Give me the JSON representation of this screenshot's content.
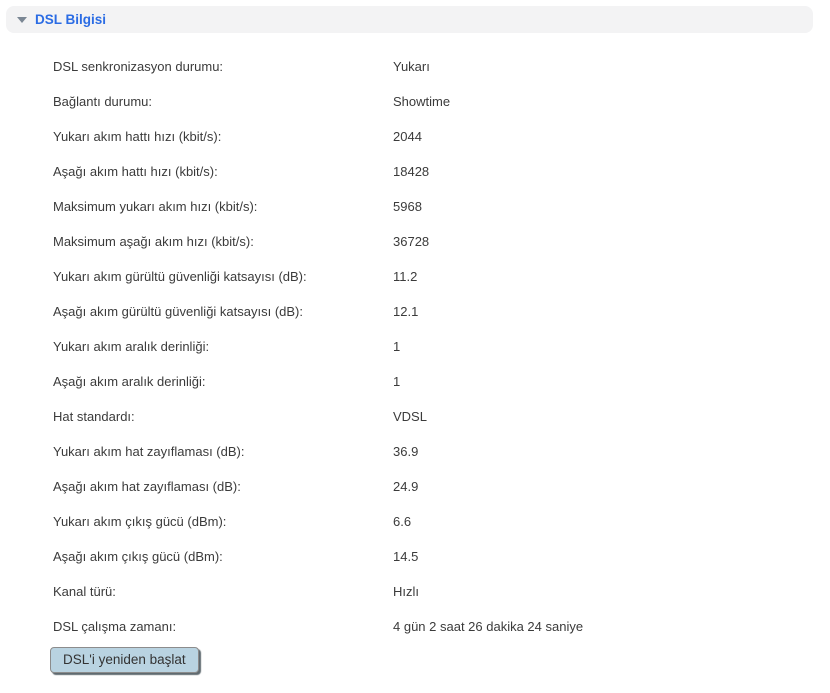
{
  "panel": {
    "title": "DSL Bilgisi",
    "collapse_icon": "triangle-down-icon"
  },
  "rows": [
    {
      "label": "DSL senkronizasyon durumu:",
      "value": "Yukarı"
    },
    {
      "label": "Bağlantı durumu:",
      "value": "Showtime"
    },
    {
      "label": "Yukarı akım hattı hızı (kbit/s):",
      "value": "2044"
    },
    {
      "label": "Aşağı akım hattı hızı (kbit/s):",
      "value": "18428"
    },
    {
      "label": "Maksimum yukarı akım hızı (kbit/s):",
      "value": "5968"
    },
    {
      "label": "Maksimum aşağı akım hızı (kbit/s):",
      "value": "36728"
    },
    {
      "label": "Yukarı akım gürültü güvenliği katsayısı (dB):",
      "value": "11.2"
    },
    {
      "label": "Aşağı akım gürültü güvenliği katsayısı (dB):",
      "value": "12.1"
    },
    {
      "label": "Yukarı akım aralık derinliği:",
      "value": "1"
    },
    {
      "label": "Aşağı akım aralık derinliği:",
      "value": "1"
    },
    {
      "label": "Hat standardı:",
      "value": "VDSL"
    },
    {
      "label": "Yukarı akım hat zayıflaması (dB):",
      "value": "36.9"
    },
    {
      "label": "Aşağı akım hat zayıflaması (dB):",
      "value": "24.9"
    },
    {
      "label": "Yukarı akım çıkış gücü (dBm):",
      "value": "6.6"
    },
    {
      "label": "Aşağı akım çıkış gücü (dBm):",
      "value": "14.5"
    },
    {
      "label": "Kanal türü:",
      "value": "Hızlı"
    },
    {
      "label": "DSL çalışma zamanı:",
      "value": "4 gün 2 saat 26 dakika 24 saniye"
    }
  ],
  "button": {
    "label": "DSL'i yeniden başlat"
  },
  "colors": {
    "header_bg": "#f3f3f4",
    "header_text": "#2b6ce4",
    "triangle": "#7b8794",
    "body_text": "#3b3b3b",
    "button_bg": "#b9d3e1",
    "button_border": "#8c8c8c",
    "button_shadow": "#5f6a70"
  }
}
